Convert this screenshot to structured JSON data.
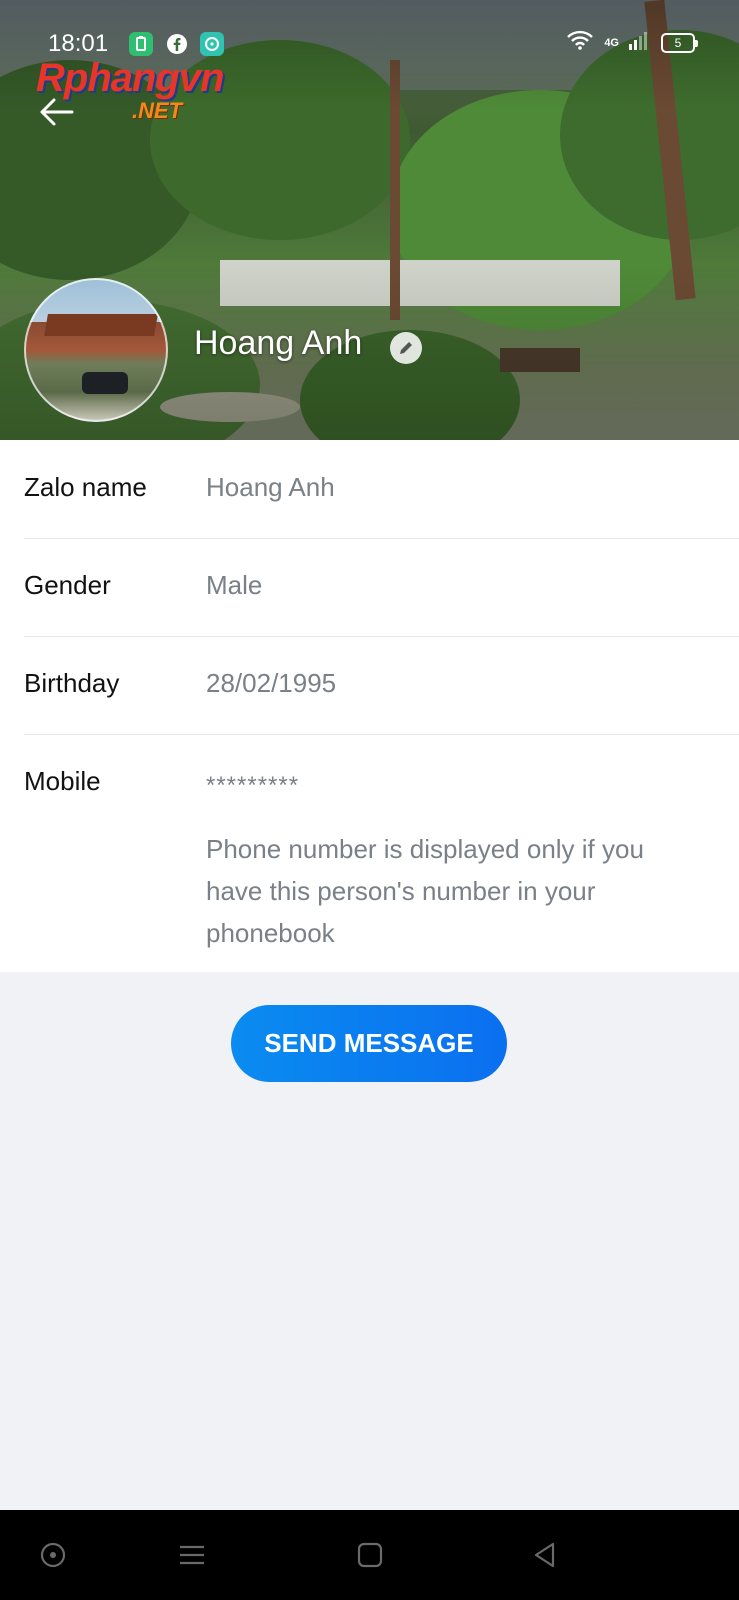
{
  "status_bar": {
    "time": "18:01",
    "network": "4G",
    "battery": "5",
    "icons": [
      "battery-saver-icon",
      "facebook-icon",
      "chat-bubble-icon",
      "wifi-icon",
      "signal-icon"
    ]
  },
  "watermark": {
    "brand": "Rphangvn",
    "suffix": ".NET"
  },
  "header": {
    "name": "Hoang Anh"
  },
  "info": {
    "zalo_name_label": "Zalo name",
    "zalo_name_value": "Hoang Anh",
    "gender_label": "Gender",
    "gender_value": "Male",
    "birthday_label": "Birthday",
    "birthday_value": "28/02/1995",
    "mobile_label": "Mobile",
    "mobile_value": "*********",
    "mobile_note": "Phone number is displayed only if you have this person's number in your phonebook"
  },
  "actions": {
    "send_message": "SEND MESSAGE"
  },
  "colors": {
    "accent": "#0a8cf0",
    "background": "#f0f2f5",
    "label": "#121212",
    "value": "#7a8088"
  }
}
